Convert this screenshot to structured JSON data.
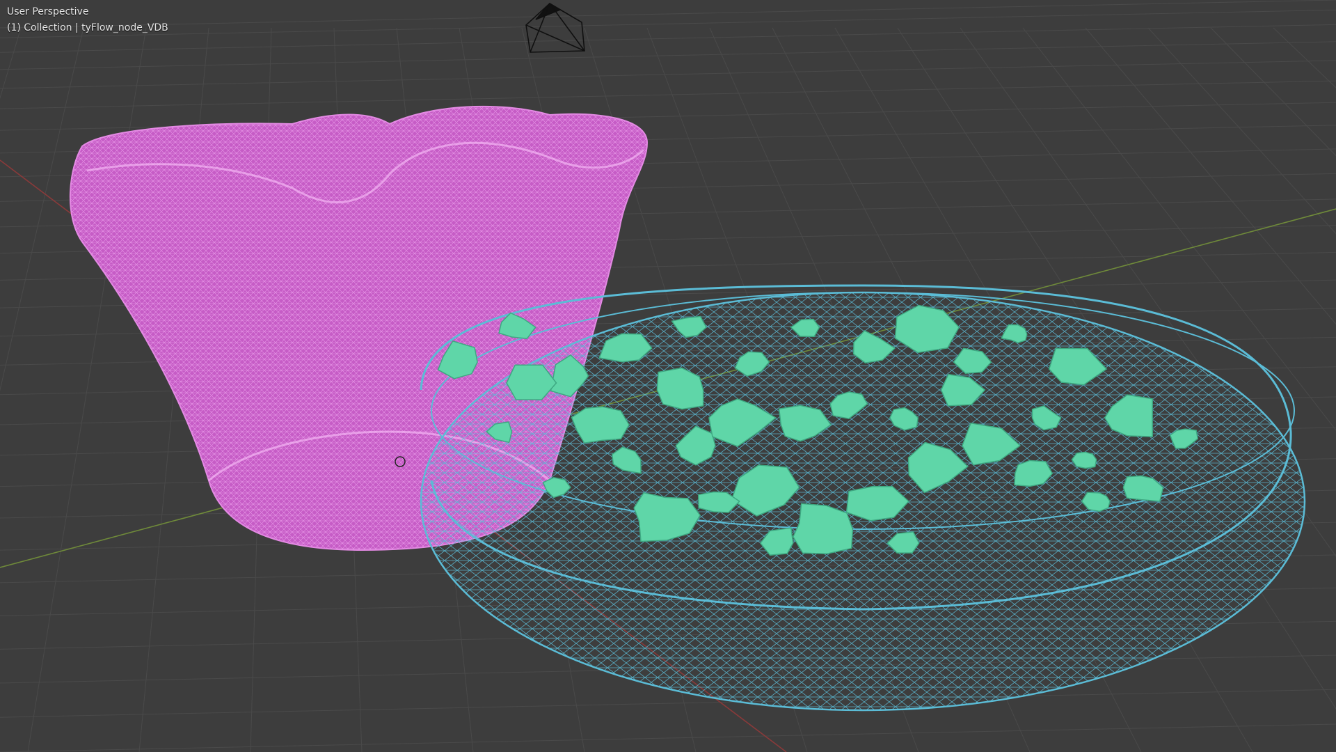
{
  "viewport": {
    "view_name": "User Perspective",
    "collection_info": "(1) Collection | tyFlow_node_VDB"
  },
  "colors": {
    "background": "#3d3d3d",
    "grid_line": "#4a4a4a",
    "x_axis": "#8a3a3a",
    "y_axis": "#6f8a3a",
    "flower_wire": "#e07ae0",
    "flower_fill": "#c45cc4",
    "bowl_wire": "#5bbcd6",
    "fragments": "#5fd6a8",
    "camera_wire": "#101010"
  },
  "objects": [
    {
      "name": "tyFlow_node_VDB",
      "type": "mesh"
    },
    {
      "name": "bowl",
      "type": "mesh"
    },
    {
      "name": "fragments",
      "type": "mesh"
    },
    {
      "name": "camera",
      "type": "camera"
    }
  ]
}
